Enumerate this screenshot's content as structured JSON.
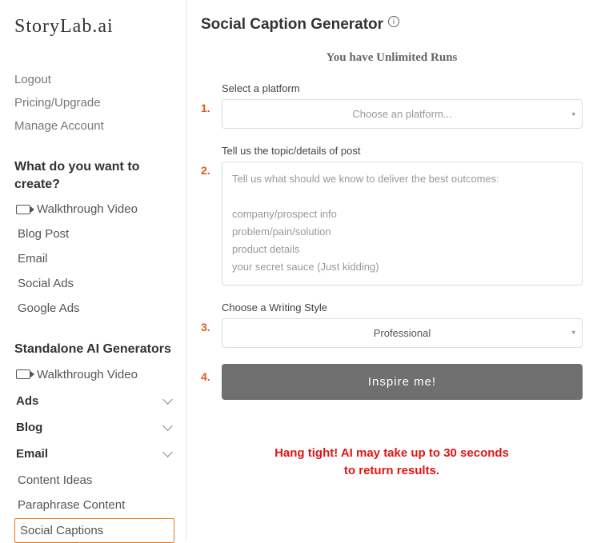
{
  "brand": "StoryLab.ai",
  "account_links": {
    "logout": "Logout",
    "pricing": "Pricing/Upgrade",
    "manage": "Manage Account"
  },
  "create": {
    "heading": "What do you want to create?",
    "items": {
      "walkthrough": "Walkthrough Video",
      "blog": "Blog Post",
      "email": "Email",
      "social_ads": "Social Ads",
      "google_ads": "Google Ads"
    }
  },
  "standalone": {
    "heading": "Standalone AI Generators",
    "walkthrough": "Walkthrough Video",
    "ads": "Ads",
    "blog": "Blog",
    "email": "Email",
    "content_ideas": "Content Ideas",
    "paraphrase": "Paraphrase Content",
    "social_captions": "Social Captions"
  },
  "page": {
    "title": "Social Caption Generator",
    "info_glyph": "i",
    "runs": "You have Unlimited Runs"
  },
  "steps": {
    "n1": "1.",
    "n2": "2.",
    "n3": "3.",
    "n4": "4.",
    "platform_label": "Select a platform",
    "platform_placeholder": "Choose an platform...",
    "topic_label": "Tell us the topic/details of post",
    "topic_placeholder_l1": "Tell us what should we know to deliver the best outcomes:",
    "topic_placeholder_l2": "company/prospect info",
    "topic_placeholder_l3": "problem/pain/solution",
    "topic_placeholder_l4": "product details",
    "topic_placeholder_l5": "your secret sauce (Just kidding)",
    "style_label": "Choose a Writing Style",
    "style_value": "Professional",
    "inspire": "Inspire me!"
  },
  "wait": {
    "l1": "Hang tight! AI may take up to 30 seconds",
    "l2": "to return results."
  }
}
